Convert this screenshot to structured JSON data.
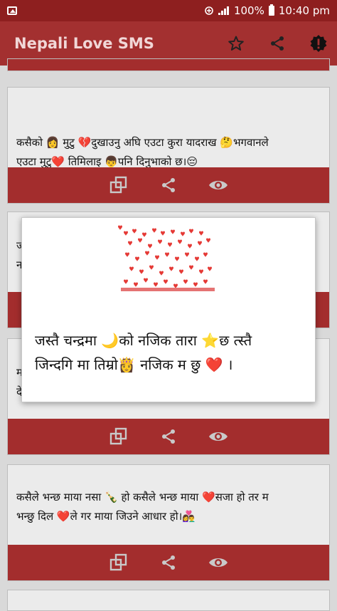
{
  "status_bar": {
    "battery": "100%",
    "time": "10:40 pm"
  },
  "app_bar": {
    "title": "Nepali Love SMS",
    "actions": [
      {
        "name": "star-icon"
      },
      {
        "name": "share-icon"
      },
      {
        "name": "info-badge-icon"
      }
    ]
  },
  "cards": [
    {
      "line1": "कसैको 👩 मुटु 💔दुखाउनु अघि एउटा कुरा यादराख 🤔भगवानले",
      "line2": "एउटा मुटु❤️ तिमिलाइ 👦पनि दिनुभाको छ।😔"
    },
    {
      "line1": "ज",
      "line2": "न"
    },
    {
      "line1": "म",
      "line2": "दे"
    },
    {
      "line1": "कसैले भन्छ माया नसा  🍾 हो कसैले भन्छ माया ❤️सजा हो तर म",
      "line2": "भन्छु दिल ❤️ले गर माया जिउने आधार हो।👩‍❤️‍👨"
    }
  ],
  "card_actions": [
    "copy-icon",
    "share-icon",
    "view-icon"
  ],
  "dialog": {
    "line1": "जस्तै चन्द्रमा 🌙को नजिक तारा ⭐छ त्स्तै",
    "line2": "जिन्दगि मा तिम्रो👸 नजिक म छु ❤️ ।"
  },
  "colors": {
    "status_bar": "#8e1f1f",
    "app_bar": "#a33030",
    "card_bar": "#a32d2d",
    "card_bg": "#ebebeb",
    "heart": "#e53935"
  }
}
